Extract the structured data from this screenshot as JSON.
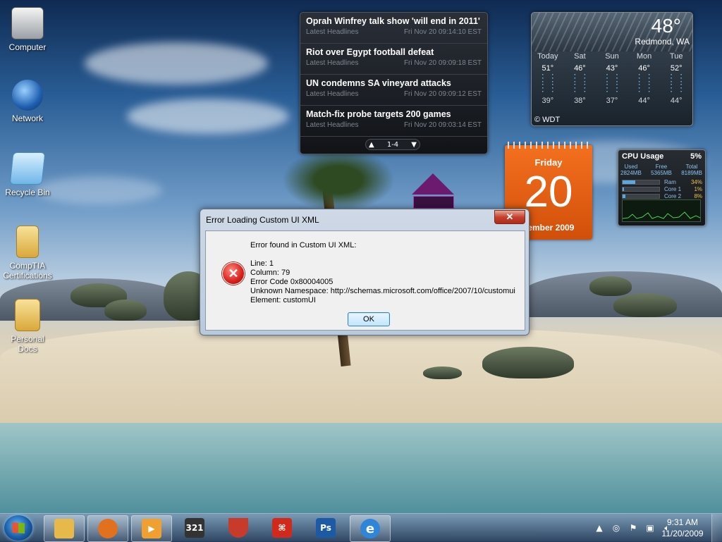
{
  "desktop": {
    "icons": [
      {
        "label": "Computer",
        "icon": "computer-icon"
      },
      {
        "label": "Network",
        "icon": "network-icon"
      },
      {
        "label": "Recycle Bin",
        "icon": "recycle-bin-icon"
      },
      {
        "label": "CompTIA Certifications",
        "icon": "folder-icon"
      },
      {
        "label": "Personal Docs",
        "icon": "folder-icon"
      }
    ]
  },
  "news": {
    "items": [
      {
        "title": "Oprah Winfrey talk show 'will end in 2011'",
        "source": "Latest Headlines",
        "time": "Fri Nov 20 09:14:10 EST"
      },
      {
        "title": "Riot over Egypt football defeat",
        "source": "Latest Headlines",
        "time": "Fri Nov 20 09:09:18 EST"
      },
      {
        "title": "UN condemns SA vineyard attacks",
        "source": "Latest Headlines",
        "time": "Fri Nov 20 09:09:12 EST"
      },
      {
        "title": "Match-fix probe targets 200 games",
        "source": "Latest Headlines",
        "time": "Fri Nov 20 09:03:14 EST"
      }
    ],
    "pager": "1-4"
  },
  "weather": {
    "temp": "48°",
    "city": "Redmond, WA",
    "credit": "© WDT",
    "days": [
      {
        "name": "Today",
        "hi": "51°",
        "lo": "39°"
      },
      {
        "name": "Sat",
        "hi": "46°",
        "lo": "38°"
      },
      {
        "name": "Sun",
        "hi": "43°",
        "lo": "37°"
      },
      {
        "name": "Mon",
        "hi": "46°",
        "lo": "44°"
      },
      {
        "name": "Tue",
        "hi": "52°",
        "lo": "44°"
      }
    ]
  },
  "calendar": {
    "day_name": "Friday",
    "day_number": "20",
    "month_year": "vember 2009"
  },
  "cpu": {
    "title": "CPU Usage",
    "percent": "5%",
    "used_label": "Used",
    "used": "2824MB",
    "free_label": "Free",
    "free": "5365MB",
    "total_label": "Total",
    "total": "8189MB",
    "bars": [
      {
        "label": "Ram",
        "value": "34%",
        "fill": 0.34
      },
      {
        "label": "Core 1",
        "value": "1%",
        "fill": 0.01
      },
      {
        "label": "Core 2",
        "value": "8%",
        "fill": 0.08
      }
    ]
  },
  "dialog": {
    "title": "Error Loading Custom UI XML",
    "close_label": "✕",
    "lines": [
      "Error found in Custom UI XML:",
      "",
      "Line: 1",
      "Column: 79",
      "Error Code 0x80004005",
      "Unknown Namespace: http://schemas.microsoft.com/office/2007/10/customui",
      "Element: customUI"
    ],
    "ok_label": "OK"
  },
  "taskbar": {
    "buttons": [
      {
        "icon": "explorer-folder-icon",
        "color": "#e6b94a"
      },
      {
        "icon": "firefox-icon",
        "color": "#e2711d"
      },
      {
        "icon": "media-player-icon",
        "color": "#f0a030"
      },
      {
        "icon": "media-player-classic-icon",
        "label": "321",
        "color": "#333333"
      },
      {
        "icon": "drink-icon",
        "color": "#c83a2a"
      },
      {
        "icon": "acrobat-reader-icon",
        "color": "#d12a1d"
      },
      {
        "icon": "photoshop-icon",
        "label": "Ps",
        "color": "#1c5aa6"
      },
      {
        "icon": "internet-explorer-icon",
        "label": "e",
        "color": "#2f86d8"
      }
    ],
    "clock_time": "9:31 AM",
    "clock_date": "11/20/2009"
  },
  "colors": {
    "dialog_accent": "#3c7fb1",
    "calendar_orange": "#f3701f",
    "error_red": "#d8201a"
  }
}
